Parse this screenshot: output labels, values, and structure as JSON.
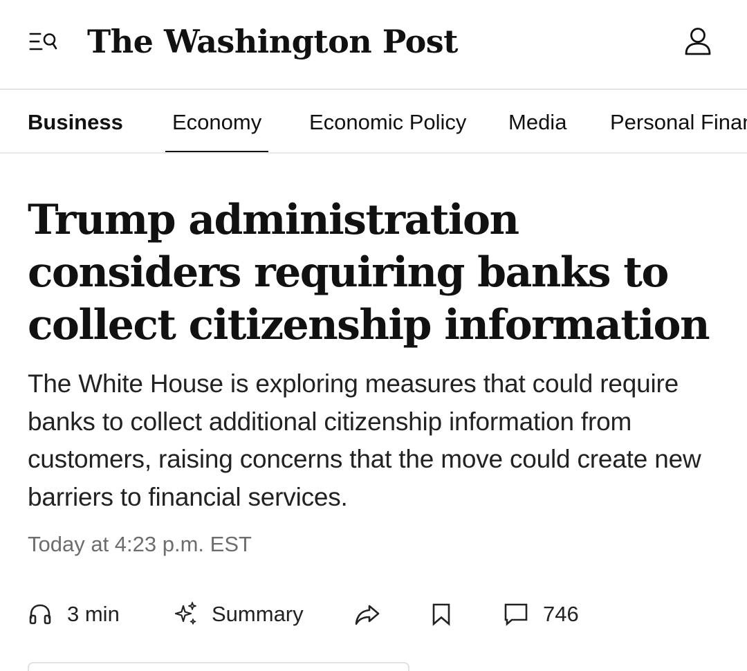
{
  "header": {
    "masthead": "The Washington Post",
    "menu_search_icon": "menu-search-icon",
    "account_icon": "user-icon"
  },
  "nav": {
    "active_section": "Business",
    "selected": "Economy",
    "items": [
      {
        "label": "Business"
      },
      {
        "label": "Economy"
      },
      {
        "label": "Economic Policy"
      },
      {
        "label": "Media"
      },
      {
        "label": "Personal Finance"
      }
    ]
  },
  "article": {
    "headline": "Trump administration considers requiring banks to collect citizenship information",
    "dek": "The White House is exploring measures that could require banks to collect additional citizenship information from customers, raising concerns that the move could create new barriers to financial services.",
    "timestamp": "Today at 4:23 p.m. EST"
  },
  "actions": {
    "listen": {
      "icon": "headphones-icon",
      "label": "3 min"
    },
    "summary": {
      "icon": "sparkle-icon",
      "label": "Summary"
    },
    "share": {
      "icon": "share-arrow-icon"
    },
    "save": {
      "icon": "bookmark-icon"
    },
    "comments": {
      "icon": "comment-icon",
      "count": "746"
    }
  },
  "colors": {
    "text": "#111111",
    "muted": "#6d6d6d",
    "divider": "#e4e4e4",
    "background": "#ffffff"
  }
}
